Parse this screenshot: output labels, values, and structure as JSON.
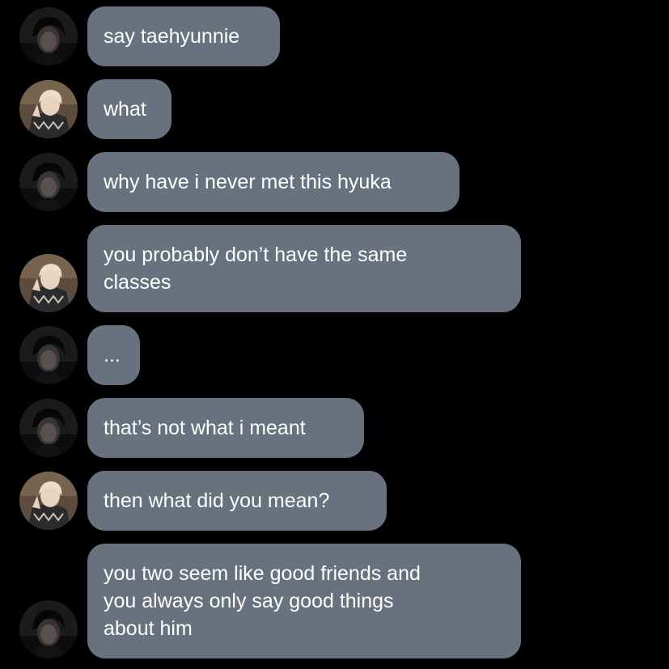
{
  "conversation": {
    "messages": [
      {
        "sender": "dark-hair",
        "text": "say taehyunnie"
      },
      {
        "sender": "blond-hair",
        "text": "what"
      },
      {
        "sender": "dark-hair",
        "text": "why have i never met this hyuka"
      },
      {
        "sender": "blond-hair",
        "text": "you probably don’t have the same\nclasses"
      },
      {
        "sender": "dark-hair",
        "text": "..."
      },
      {
        "sender": "dark-hair",
        "text": "that’s not what i meant"
      },
      {
        "sender": "blond-hair",
        "text": "then what did you mean?"
      },
      {
        "sender": "dark-hair",
        "text": "you two seem like good friends and\nyou always only say good things\nabout him"
      }
    ]
  },
  "colors": {
    "background": "#000000",
    "bubble": "#68727e",
    "text": "#ffffff"
  },
  "icons": {
    "dark-hair": "dark-hair-avatar-icon",
    "blond-hair": "blond-hair-avatar-icon"
  }
}
